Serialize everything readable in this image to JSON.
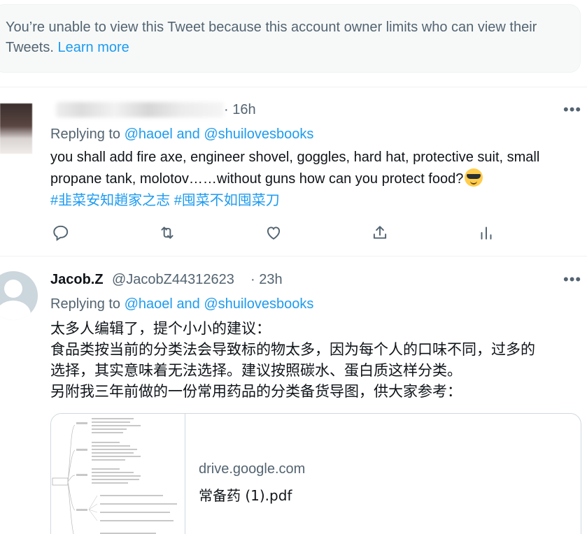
{
  "notice": {
    "text": "You’re unable to view this Tweet because this account owner limits who can view their Tweets.",
    "link": "Learn more"
  },
  "tweet1": {
    "time": "· 16h",
    "replying_to": "Replying to",
    "handle1": "@haoel",
    "and": "and",
    "handle2": "@shuilovesbooks",
    "body": "you shall add fire axe, engineer shovel, goggles, hard hat, protective suit, small propane tank, molotov……without guns how can you protect food?",
    "emoji": "smiling-face-with-sunglasses",
    "hashtags": [
      "#韭菜安知趙家之志",
      "#囤菜不如囤菜刀"
    ]
  },
  "tweet2": {
    "name": "Jacob.Z",
    "handle": "@JacobZ44312623",
    "time": "· 23h",
    "replying_to": "Replying to",
    "handle1": "@haoel",
    "and": "and",
    "handle2": "@shuilovesbooks",
    "lines": [
      "太多人编辑了，提个小小的建议：",
      "食品类按当前的分类法会导致标的物太多，因为每个人的口味不同，过多的",
      "选择，其实意味着无法选择。建议按照碳水、蛋白质这样分类。",
      "另附我三年前做的一份常用药品的分类备货导图，供大家参考："
    ],
    "card": {
      "domain": "drive.google.com",
      "title": "常备药 (1).pdf"
    }
  },
  "colors": {
    "accent": "#1d9bf0",
    "secondary_text": "#536471",
    "primary_text": "#0f1419",
    "border": "#cfd9de"
  }
}
